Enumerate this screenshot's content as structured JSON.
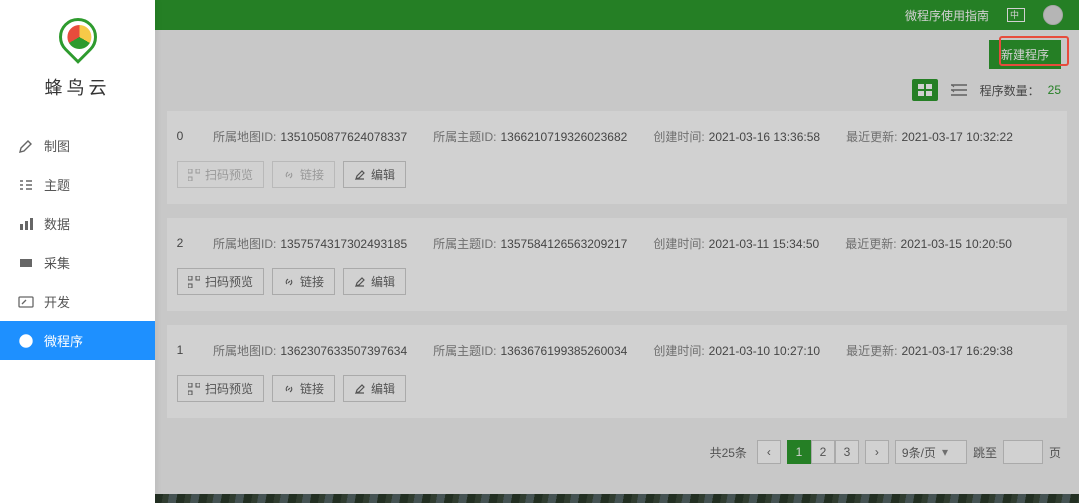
{
  "topbar": {
    "guide_label": "微程序使用指南"
  },
  "brand": {
    "name": "蜂鸟云"
  },
  "sidebar": {
    "items": [
      {
        "label": "制图"
      },
      {
        "label": "主题"
      },
      {
        "label": "数据"
      },
      {
        "label": "采集"
      },
      {
        "label": "开发"
      },
      {
        "label": "微程序"
      }
    ],
    "active_index": 5
  },
  "toolbar": {
    "new_program_label": "新建程序",
    "count_label": "程序数量：",
    "count_value": "25"
  },
  "labels": {
    "map_id": "所属地图ID:",
    "theme_id": "所属主题ID:",
    "created": "创建时间:",
    "updated": "最近更新:",
    "scan_preview": "扫码预览",
    "link": "链接",
    "edit": "编辑"
  },
  "items": [
    {
      "lead": "0",
      "map_id": "1351050877624078337",
      "theme_id": "1366210719326023682",
      "created": "2021-03-16 13:36:58",
      "updated": "2021-03-17 10:32:22",
      "scan_disabled": true,
      "link_disabled": true
    },
    {
      "lead": "2",
      "map_id": "1357574317302493185",
      "theme_id": "1357584126563209217",
      "created": "2021-03-11 15:34:50",
      "updated": "2021-03-15 10:20:50",
      "scan_disabled": false,
      "link_disabled": false
    },
    {
      "lead": "1",
      "map_id": "1362307633507397634",
      "theme_id": "1363676199385260034",
      "created": "2021-03-10 10:27:10",
      "updated": "2021-03-17 16:29:38",
      "scan_disabled": false,
      "link_disabled": false
    }
  ],
  "pagination": {
    "total_label": "共25条",
    "pages": [
      "1",
      "2",
      "3"
    ],
    "active_page": "1",
    "per_page_label": "9条/页",
    "jump_label": "跳至",
    "page_suffix": "页"
  }
}
